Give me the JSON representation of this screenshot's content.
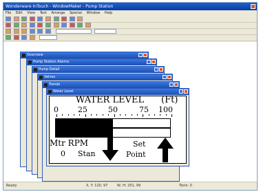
{
  "window": {
    "title": "Wonderware InTouch - WindowMaker - Pump Station"
  },
  "menu": [
    "File",
    "Edit",
    "View",
    "Text",
    "Arrange",
    "Special",
    "Window",
    "Help"
  ],
  "children": [
    {
      "title": "Overview"
    },
    {
      "title": "Pump Station Alarms"
    },
    {
      "title": "Pump Detail"
    },
    {
      "title": "Valves"
    },
    {
      "title": "Trends"
    },
    {
      "title": "Water Level"
    }
  ],
  "gauge": {
    "title": "WATER LEVEL",
    "unit": "(Ft)",
    "scale": [
      "0",
      "25",
      "50",
      "75",
      "100"
    ],
    "level": 50
  },
  "labels": {
    "mtr_rpm": "Mtr RPM",
    "rpm_value": "0",
    "status": "Stan",
    "set": "Set",
    "point": "Point"
  },
  "status_bar": {
    "left": "Ready",
    "mid1": "X, Y: 120, 97",
    "mid2": "W, H: 201, 99",
    "right": "Tools: 0"
  },
  "colors": {
    "title_blue": "#1f5fd0",
    "panel_bg": "#ffffff",
    "fill": "#000000"
  }
}
